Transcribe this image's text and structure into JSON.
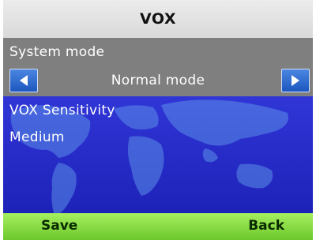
{
  "header": {
    "title": "VOX"
  },
  "system_mode": {
    "label": "System mode",
    "value": "Normal mode",
    "prev_icon": "left-arrow-icon",
    "next_icon": "right-arrow-icon"
  },
  "vox_sensitivity": {
    "label": "VOX Sensitivity",
    "value": "Medium"
  },
  "softkeys": {
    "left": "Save",
    "right": "Back"
  },
  "colors": {
    "title_bar": "#dcdcdc",
    "main_background": "#2a2fd6",
    "mode_panel": "#7f7f7f",
    "arrow_button": "#2d6ad2",
    "softkey_bar": "#8ad844"
  }
}
